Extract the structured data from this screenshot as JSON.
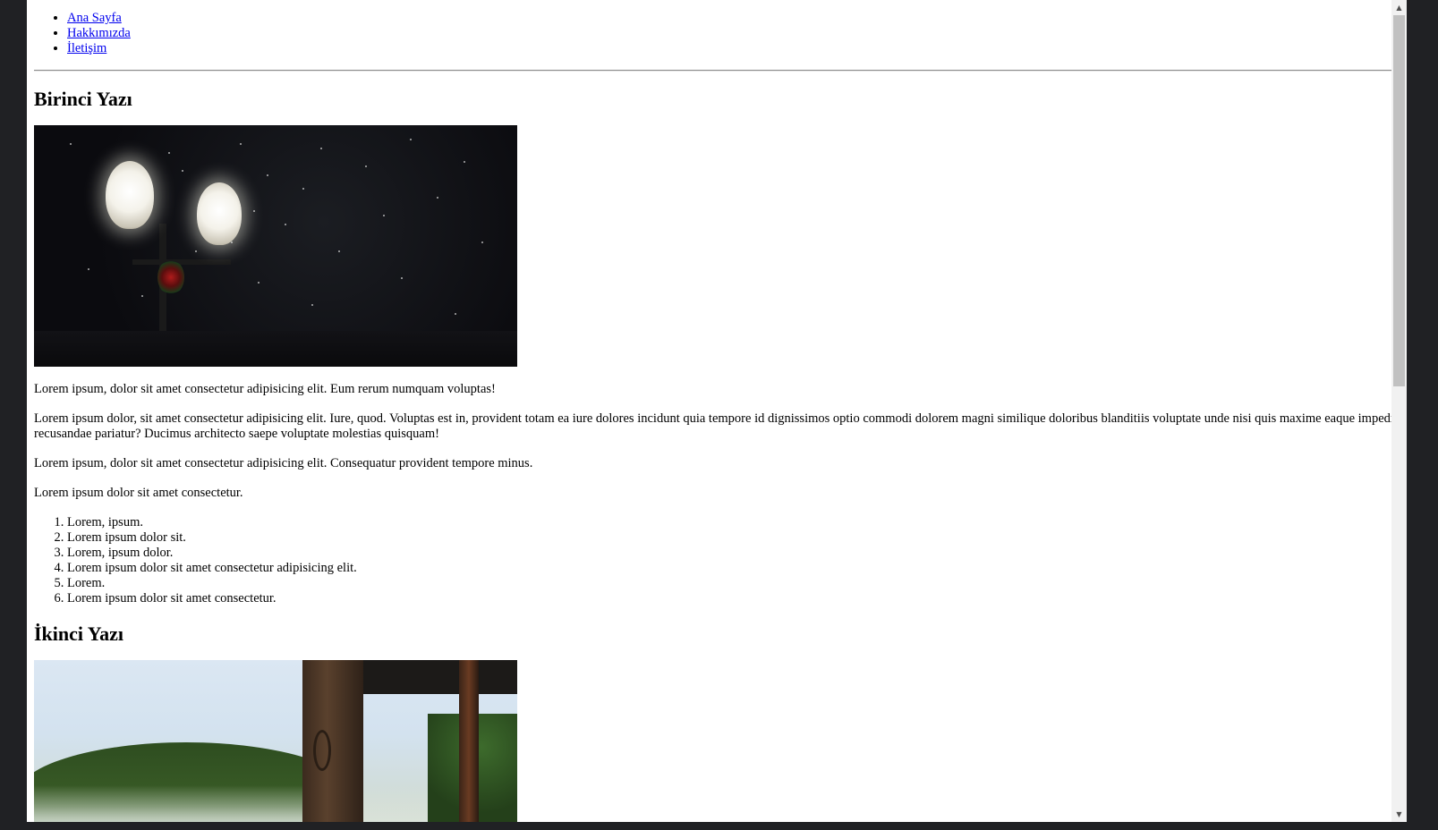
{
  "nav": {
    "items": [
      {
        "label": "Ana Sayfa"
      },
      {
        "label": "Hakkımızda"
      },
      {
        "label": "İletişim"
      }
    ]
  },
  "post1": {
    "title": "Birinci Yazı",
    "paragraphs": [
      "Lorem ipsum, dolor sit amet consectetur adipisicing elit. Eum rerum numquam voluptas!",
      "Lorem ipsum dolor, sit amet consectetur adipisicing elit. Iure, quod. Voluptas est in, provident totam ea iure dolores incidunt quia tempore id dignissimos optio commodi dolorem magni similique doloribus blanditiis voluptate unde nisi quis maxime eaque impedit recusandae pariatur? Ducimus architecto saepe voluptate molestias quisquam!",
      "Lorem ipsum, dolor sit amet consectetur adipisicing elit. Consequatur provident tempore minus.",
      "Lorem ipsum dolor sit amet consectetur."
    ],
    "list": [
      "Lorem, ipsum.",
      "Lorem ipsum dolor sit.",
      "Lorem, ipsum dolor.",
      "Lorem ipsum dolor sit amet consectetur adipisicing elit.",
      "Lorem.",
      "Lorem ipsum dolor sit amet consectetur."
    ]
  },
  "post2": {
    "title": "İkinci Yazı"
  },
  "scrollbar": {
    "up_icon": "▲",
    "down_icon": "▼"
  }
}
